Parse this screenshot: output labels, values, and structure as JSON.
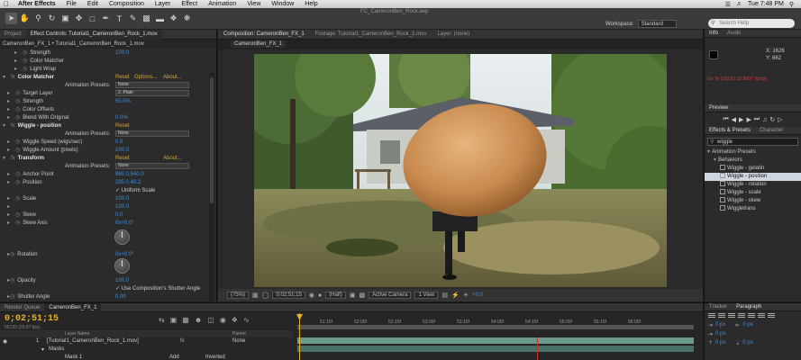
{
  "menubar": {
    "items": [
      "After Effects",
      "File",
      "Edit",
      "Composition",
      "Layer",
      "Effect",
      "Animation",
      "View",
      "Window",
      "Help"
    ],
    "clock": "Tue 7:48 PM"
  },
  "toolbar": {
    "window_title": "FC_CameronBen_Rock.aep",
    "workspace_label": "Workspace:",
    "workspace_value": "Standard",
    "search_placeholder": "Search Help"
  },
  "effect_controls": {
    "tabs": [
      "Project",
      "Effect Controls: Tutorial1_CameronBen_Rock_1.mov"
    ],
    "layer_header": "CameronBen_FX_1 • Tutorial1_CameronBen_Rock_1.mov",
    "rows": [
      {
        "kind": "prop",
        "indent": 2,
        "name": "Strength",
        "val": "100.0"
      },
      {
        "kind": "prop",
        "indent": 2,
        "name": "Color Matcher"
      },
      {
        "kind": "prop",
        "indent": 2,
        "name": "Light Wrap"
      },
      {
        "kind": "effect",
        "name": "Color Matcher",
        "reset": "Reset",
        "options": "Options...",
        "about": "About..."
      },
      {
        "kind": "preset",
        "label": "Animation Presets:",
        "value": "None"
      },
      {
        "kind": "dropdown-row",
        "indent": 1,
        "name": "Target Layer",
        "value": "2. Plate"
      },
      {
        "kind": "prop",
        "indent": 1,
        "name": "Strength",
        "val": "50.0%"
      },
      {
        "kind": "prop",
        "indent": 1,
        "name": "Color Offsets"
      },
      {
        "kind": "prop",
        "indent": 1,
        "name": "Blend With Original",
        "val": "0.0%"
      },
      {
        "kind": "effect",
        "name": "Wiggle - position",
        "reset": "Reset"
      },
      {
        "kind": "preset",
        "label": "Animation Presets:",
        "value": "None"
      },
      {
        "kind": "prop",
        "indent": 1,
        "name": "Wiggle Speed (wigs/sec)",
        "val": "0.5"
      },
      {
        "kind": "prop",
        "indent": 1,
        "name": "Wiggle Amount (pixels)",
        "val": "100.0"
      },
      {
        "kind": "effect",
        "name": "Transform",
        "reset": "Reset",
        "about": "About..."
      },
      {
        "kind": "preset",
        "label": "Animation Presets:",
        "value": "None"
      },
      {
        "kind": "prop",
        "indent": 1,
        "name": "Anchor Point",
        "val": "960.0,540.0"
      },
      {
        "kind": "prop",
        "indent": 1,
        "name": "Position",
        "val": "285.0,40.2"
      },
      {
        "kind": "check",
        "indent": 1,
        "name": "",
        "val": "Uniform Scale"
      },
      {
        "kind": "prop",
        "indent": 1,
        "name": "Scale",
        "val": "100.0"
      },
      {
        "kind": "prop",
        "indent": 1,
        "name": "",
        "val": "100.0"
      },
      {
        "kind": "prop",
        "indent": 1,
        "name": "Skew",
        "val": "0.0"
      },
      {
        "kind": "prop",
        "indent": 1,
        "name": "Skew Axis",
        "val": "0x+0.0°"
      }
    ],
    "rotation_label": "Rotation",
    "rotation_val": "0x+0.0°",
    "opacity_label": "Opacity",
    "opacity_val": "100.0",
    "shutter_check": "Use Composition's Shutter Angle",
    "shutter_label": "Shutter Angle",
    "shutter_val": "0.00"
  },
  "composition": {
    "tabs": [
      "Composition: CameronBen_FX_1",
      "Footage: Tutorial1_CameronBen_Rock_1.mov",
      "Layer: (none)"
    ],
    "subtab": "CameronBen_FX_1",
    "footer": {
      "zoom": "(75%)",
      "timecode": "0;02;51;15",
      "resolution": "(Half)",
      "camera": "Active Camera",
      "views": "1 View",
      "exposure": "+0.0"
    }
  },
  "info_panel": {
    "tabs": [
      "Info",
      "Audio"
    ],
    "x": "X: 1626",
    "y": "Y: 662",
    "status_line": "Go To 0;02;51;15 INDT (drop)"
  },
  "preview_panel": {
    "title": "Preview"
  },
  "effects_presets": {
    "tabs": [
      "Effects & Presets",
      "Character"
    ],
    "search_value": "wiggle",
    "items": [
      {
        "label": "Animation Presets",
        "level": 0,
        "folder": true
      },
      {
        "label": "Behaviors",
        "level": 1,
        "folder": true
      },
      {
        "label": "Wiggle - gelatin",
        "level": 2
      },
      {
        "label": "Wiggle - position",
        "level": 2,
        "selected": true
      },
      {
        "label": "Wiggle - rotation",
        "level": 2
      },
      {
        "label": "Wiggle - scale",
        "level": 2
      },
      {
        "label": "Wiggle - skew",
        "level": 2
      },
      {
        "label": "Wiggletrans",
        "level": 2
      }
    ]
  },
  "timeline": {
    "tabs": [
      "Render Queue",
      "CameronBen_FX_1"
    ],
    "timecode": "0;02;51;15",
    "frames": "05133 (29.97 fps)",
    "col_headers": [
      "Layer Name",
      "Parent"
    ],
    "layer1": {
      "num": "1",
      "name": "[Tutorial1_CameronBen_Rock_1.mov]",
      "parent": "None"
    },
    "layer2": {
      "name": "Masks"
    },
    "layer3": {
      "name": "Mask 1",
      "mode": "Add",
      "inverted": "Inverted"
    },
    "ruler": [
      "51:15f",
      "52:00f",
      "52:15f",
      "53:00f",
      "53:15f",
      "54:00f",
      "54:15f",
      "55:00f",
      "55:15f",
      "56:00f"
    ]
  },
  "paragraph_panel": {
    "tabs": [
      "Tracker",
      "Paragraph"
    ],
    "rows": [
      "0 px",
      "0 px",
      "0 px",
      "0 px",
      "0 px"
    ]
  },
  "colors": {
    "accent_blue": "#3d8fe0",
    "accent_orange": "#d9a33b",
    "timecode": "#e8b02a"
  }
}
